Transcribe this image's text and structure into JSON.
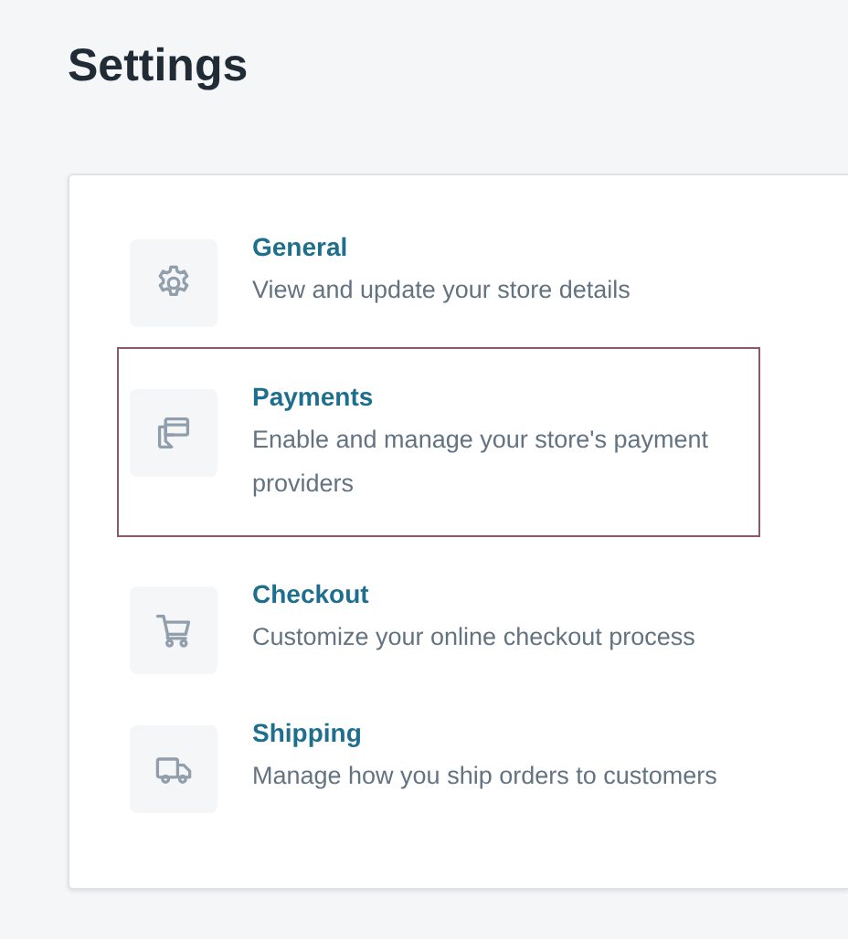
{
  "page": {
    "title": "Settings"
  },
  "items": [
    {
      "kind": "gear",
      "title": "General",
      "description": "View and update your store details",
      "selected": false
    },
    {
      "kind": "payment",
      "title": "Payments",
      "description": "Enable and manage your store's payment providers",
      "selected": true
    },
    {
      "kind": "cart",
      "title": "Checkout",
      "description": "Customize your online checkout process",
      "selected": false
    },
    {
      "kind": "truck",
      "title": "Shipping",
      "description": "Manage how you ship orders to customers",
      "selected": false
    }
  ]
}
